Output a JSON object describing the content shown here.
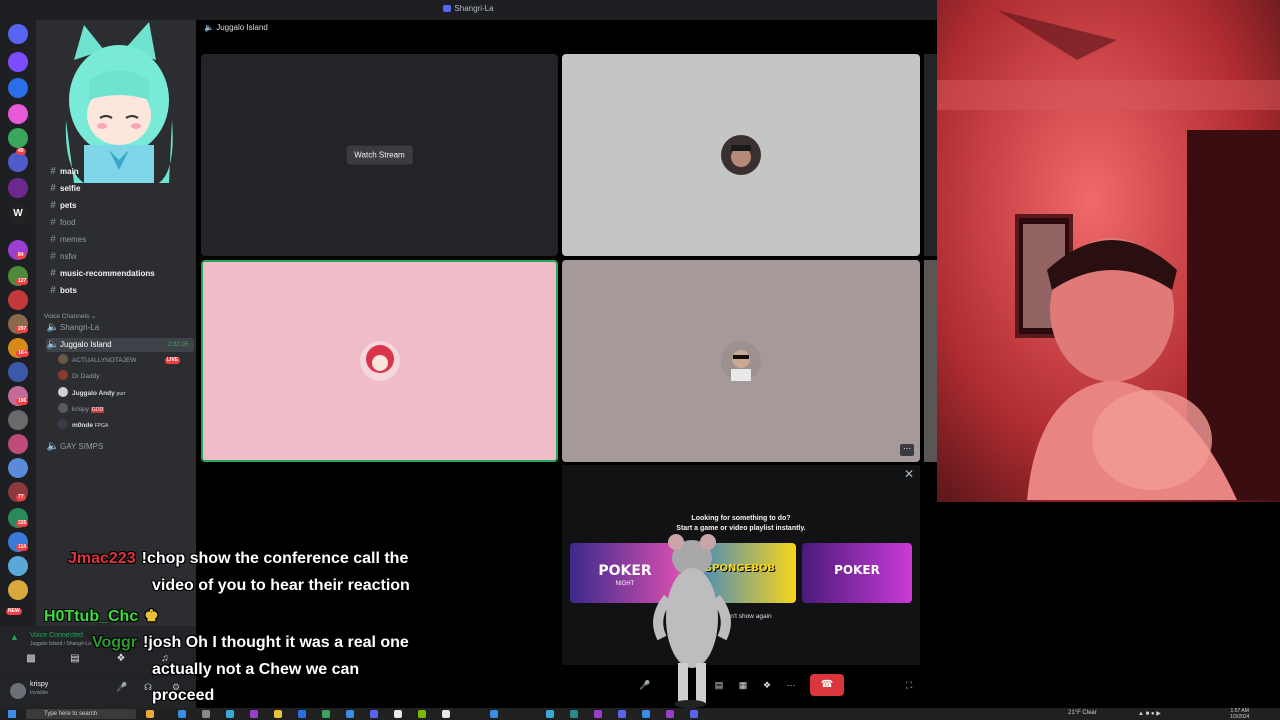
{
  "window": {
    "title": "Shangri-La"
  },
  "call": {
    "channel_name": "Juggalo Island"
  },
  "server_rail": {
    "badges": [
      "49",
      "84",
      "127",
      "297",
      "1K+",
      "196",
      "77",
      "225",
      "114",
      "NEW"
    ]
  },
  "channels": {
    "text": [
      {
        "name": "main",
        "unread": true
      },
      {
        "name": "selfie",
        "unread": true
      },
      {
        "name": "pets",
        "unread": true
      },
      {
        "name": "food",
        "unread": false
      },
      {
        "name": "memes",
        "unread": false
      },
      {
        "name": "nsfw",
        "unread": false
      },
      {
        "name": "music-recommendations",
        "unread": true
      },
      {
        "name": "bots",
        "unread": true
      }
    ],
    "voice_header": "Voice Channels",
    "voice": [
      {
        "name": "Shangri-La"
      },
      {
        "name": "Juggalo Island",
        "timer": "2:32:05",
        "active": true
      },
      {
        "name": "GAY SIMPS"
      }
    ],
    "voice_users": [
      {
        "name": "ACTUALLYNOTAJEW",
        "live": "LIVE",
        "color": "#949ba4"
      },
      {
        "name": "Dr Daddy",
        "color": "#949ba4"
      },
      {
        "name": "Juggalo Andy",
        "tag": "purr",
        "color": "#dbdee1"
      },
      {
        "name": "krispy",
        "tag": "GOD",
        "color": "#949ba4"
      },
      {
        "name": "m0nde",
        "tag": "FPGA",
        "color": "#dbdee1"
      }
    ]
  },
  "voice_panel": {
    "status": "Voice Connected",
    "location": "Juggalo Island / Shangri-La"
  },
  "user": {
    "name": "krispy",
    "status": "Invisible"
  },
  "tiles": {
    "watch_stream_label": "Watch Stream"
  },
  "activity": {
    "heading": "Looking for something to do?",
    "subheading": "Start a game or video playlist instantly.",
    "cards": [
      {
        "label": "POKER",
        "sublabel": "NIGHT",
        "color_a": "#3b2a8c",
        "color_b": "#d94fb0"
      },
      {
        "label": "SPONGEBOB",
        "color_a": "#f7d51d",
        "color_b": "#2f7fd3"
      },
      {
        "label": "POKER",
        "color_a": "#4b1a7a",
        "color_b": "#c93bd6"
      }
    ],
    "dont_show": "Don't show again"
  },
  "chat": [
    {
      "nick": "Jmac223",
      "nick_color": "#e0323c",
      "message": "!chop show the conference call the"
    },
    {
      "nick": "",
      "nick_color": "#ffffff",
      "message": "video of you to hear their reaction"
    },
    {
      "nick": "H0Ttub_Chc",
      "nick_color": "#3ddc3d",
      "message": ""
    },
    {
      "nick": "Voggr",
      "nick_color": "#2f9a2f",
      "message": "!josh Oh I thought it was a real one"
    },
    {
      "nick": "",
      "nick_color": "#ffffff",
      "message": "actually not a Chew we can"
    },
    {
      "nick": "",
      "nick_color": "#ffffff",
      "message": "proceed"
    }
  ],
  "taskbar": {
    "search_placeholder": "Type here to search",
    "weather": "21°F Clear",
    "time": "1:57 AM",
    "date": "1/3/2024"
  },
  "colors": {
    "accent": "#5865f2",
    "online": "#23a55a",
    "danger": "#da373c"
  }
}
